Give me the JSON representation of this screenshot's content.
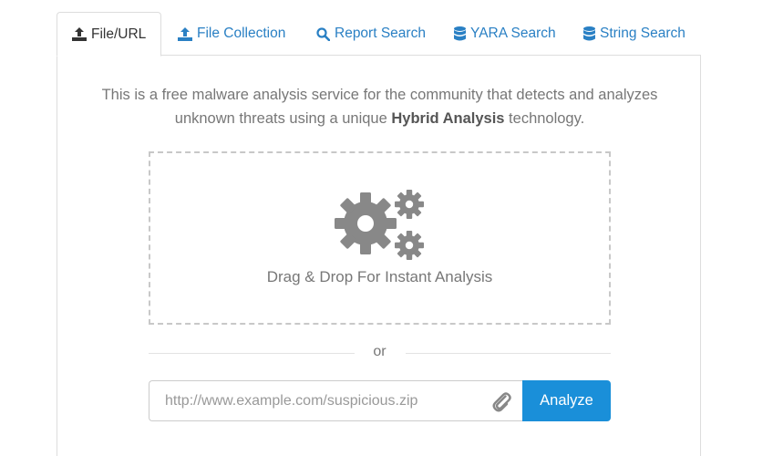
{
  "tabs": [
    {
      "label": "File/URL",
      "icon": "upload-icon",
      "active": true
    },
    {
      "label": "File Collection",
      "icon": "upload-icon",
      "active": false
    },
    {
      "label": "Report Search",
      "icon": "search-icon",
      "active": false
    },
    {
      "label": "YARA Search",
      "icon": "database-icon",
      "active": false
    },
    {
      "label": "String Search",
      "icon": "database-icon",
      "active": false
    }
  ],
  "intro": {
    "line1": "This is a free malware analysis service for the community that detects and analyzes",
    "line2_prefix": "unknown threats using a unique ",
    "line2_bold": "Hybrid Analysis",
    "line2_suffix": " technology."
  },
  "dropzone": {
    "icon": "gears-icon",
    "label": "Drag & Drop For Instant Analysis"
  },
  "divider": {
    "text": "or"
  },
  "url_form": {
    "placeholder": "http://www.example.com/suspicious.zip",
    "value": "",
    "attach_icon": "paperclip-icon",
    "button_label": "Analyze"
  },
  "colors": {
    "link": "#2a80c4",
    "button": "#1a8fd9",
    "muted_text": "#777777",
    "icon_gray": "#888888"
  }
}
